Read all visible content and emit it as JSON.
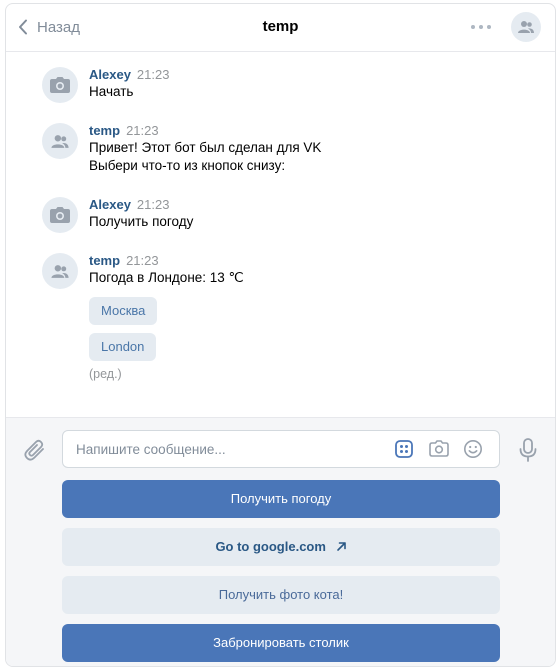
{
  "header": {
    "back_label": "Назад",
    "title": "temp"
  },
  "messages": [
    {
      "author": "Alexey",
      "time": "21:23",
      "lines": [
        "Начать"
      ],
      "avatar_icon": "camera-icon"
    },
    {
      "author": "temp",
      "time": "21:23",
      "lines": [
        "Привет! Этот бот был сделан для VK",
        "Выбери что-то из кнопок снизу:"
      ],
      "avatar_icon": "group-icon"
    },
    {
      "author": "Alexey",
      "time": "21:23",
      "lines": [
        "Получить погоду"
      ],
      "avatar_icon": "camera-icon"
    },
    {
      "author": "temp",
      "time": "21:23",
      "lines": [
        "Погода в Лондоне: 13 ℃"
      ],
      "avatar_icon": "group-icon",
      "inline_buttons": [
        "Москва",
        "London"
      ],
      "edited": "(ред.)"
    }
  ],
  "composer": {
    "placeholder": "Напишите сообщение..."
  },
  "keyboard": [
    {
      "label": "Получить погоду",
      "style": "primary"
    },
    {
      "label": "Go to google.com",
      "style": "secondary",
      "icon": "external-link-icon"
    },
    {
      "label": "Получить фото кота!",
      "style": "secondary"
    },
    {
      "label": "Забронировать столик",
      "style": "primary"
    }
  ],
  "colors": {
    "accent": "#4a76b8",
    "author_link": "#2a5885",
    "secondary_button_bg": "#e5ebf1",
    "muted_text": "#939699"
  }
}
